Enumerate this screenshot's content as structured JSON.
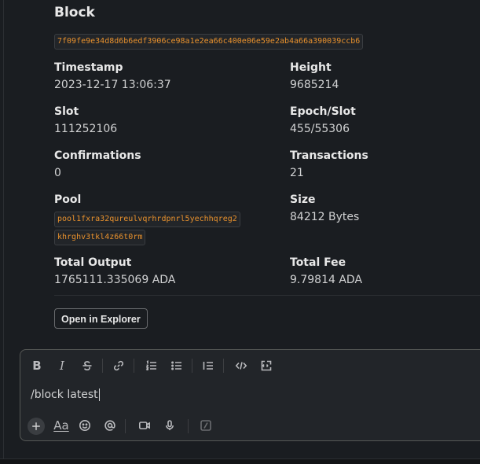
{
  "block": {
    "title": "Block",
    "hash": "7f09fe9e34d8d6b6edf3906ce98a1e2ea66c400e06e59e2ab4a66a390039ccb6",
    "timestamp_label": "Timestamp",
    "timestamp": "2023-12-17 13:06:37",
    "height_label": "Height",
    "height": "9685214",
    "slot_label": "Slot",
    "slot": "111252106",
    "epoch_slot_label": "Epoch/Slot",
    "epoch_slot": "455/55306",
    "confirmations_label": "Confirmations",
    "confirmations": "0",
    "transactions_label": "Transactions",
    "transactions": "21",
    "pool_label": "Pool",
    "pool_line1": "pool1fxra32qureulvqrhrdpnrl5yechhqreg2",
    "pool_line2": "khrghv3tkl4z66t0rm",
    "size_label": "Size",
    "size": "84212 Bytes",
    "total_output_label": "Total Output",
    "total_output": "1765111.335069 ADA",
    "total_fee_label": "Total Fee",
    "total_fee": "9.79814 ADA",
    "explorer_button": "Open in Explorer"
  },
  "composer": {
    "message": "/block latest",
    "toolbar_icons": [
      "bold-icon",
      "italic-icon",
      "strikethrough-icon",
      "link-icon",
      "ordered-list-icon",
      "bulleted-list-icon",
      "blockquote-icon",
      "code-icon",
      "code-block-icon"
    ],
    "bold_glyph": "B",
    "italic_glyph": "I",
    "format_glyph": "Aa"
  }
}
